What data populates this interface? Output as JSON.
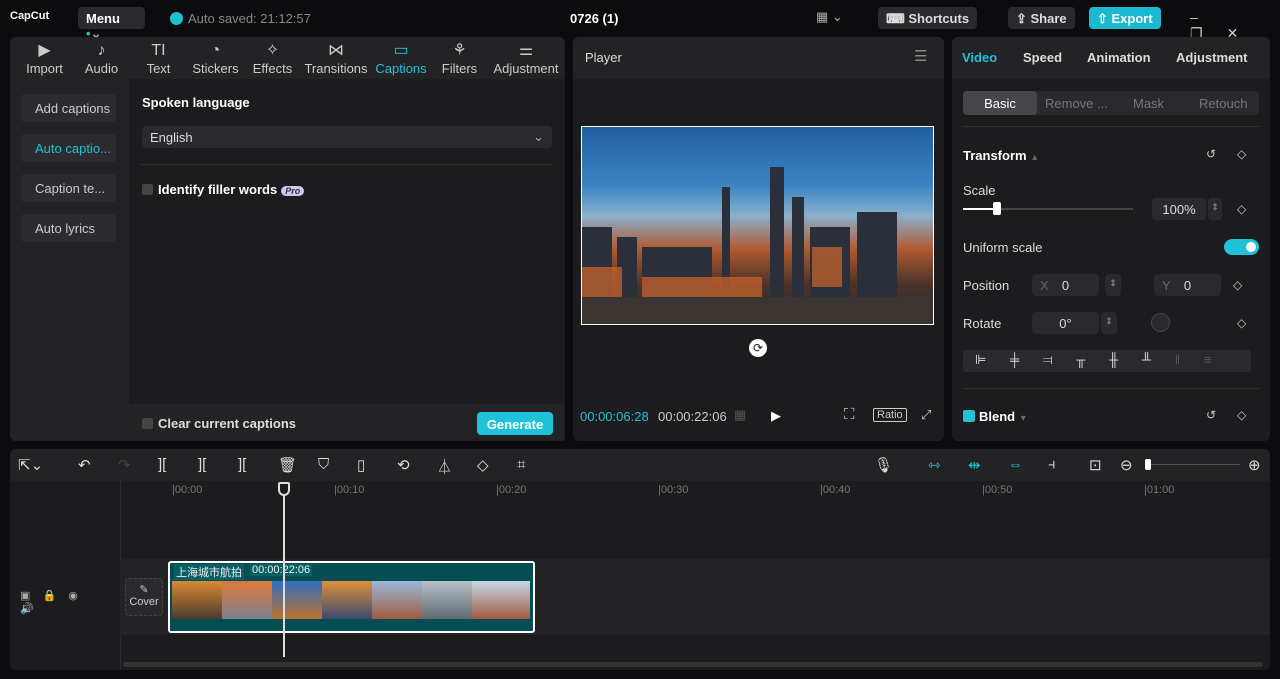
{
  "app": {
    "logo": "CapCut",
    "menu": "Menu",
    "autosave": "Auto saved: 21:12:57",
    "project_title": "0726 (1)",
    "shortcuts": "Shortcuts",
    "share": "Share",
    "export": "Export"
  },
  "media_tabs": [
    {
      "label": "Import",
      "icon": "▶"
    },
    {
      "label": "Audio",
      "icon": "♪"
    },
    {
      "label": "Text",
      "icon": "TI"
    },
    {
      "label": "Stickers",
      "icon": "◔"
    },
    {
      "label": "Effects",
      "icon": "✧"
    },
    {
      "label": "Transitions",
      "icon": "⋈"
    },
    {
      "label": "Captions",
      "icon": "▭"
    },
    {
      "label": "Filters",
      "icon": "⚘"
    },
    {
      "label": "Adjustment",
      "icon": "⚌"
    }
  ],
  "captions_menu": [
    "Add captions",
    "Auto captio...",
    "Caption te...",
    "Auto lyrics"
  ],
  "captions": {
    "spoken_language_label": "Spoken language",
    "language": "English",
    "filler_words": "Identify filler words",
    "pro": "Pro",
    "clear": "Clear current captions",
    "generate": "Generate"
  },
  "player": {
    "title": "Player",
    "current_time": "00:00:06:28",
    "total_time": "00:00:22:06",
    "ratio": "Ratio"
  },
  "inspector": {
    "tabs": [
      "Video",
      "Speed",
      "Animation",
      "Adjustment"
    ],
    "subtabs": [
      "Basic",
      "Remove ...",
      "Mask",
      "Retouch"
    ],
    "transform": "Transform",
    "scale_label": "Scale",
    "scale_value": "100%",
    "scale_fraction": 0.2,
    "uniform_scale": "Uniform scale",
    "uniform_on": true,
    "position_label": "Position",
    "x_label": "X",
    "x_value": "0",
    "y_label": "Y",
    "y_value": "0",
    "rotate_label": "Rotate",
    "rotate_value": "0°",
    "blend": "Blend"
  },
  "timeline": {
    "ticks": [
      "|00:00",
      "|00:10",
      "|00:20",
      "|00:30",
      "|00:40",
      "|00:50",
      "|01:00"
    ],
    "clip_name": "上海城市航拍",
    "clip_duration": "00:00:22:06",
    "cover": "Cover"
  },
  "colors": {
    "accent": "#1fc2d6",
    "clip": "#044d52"
  }
}
